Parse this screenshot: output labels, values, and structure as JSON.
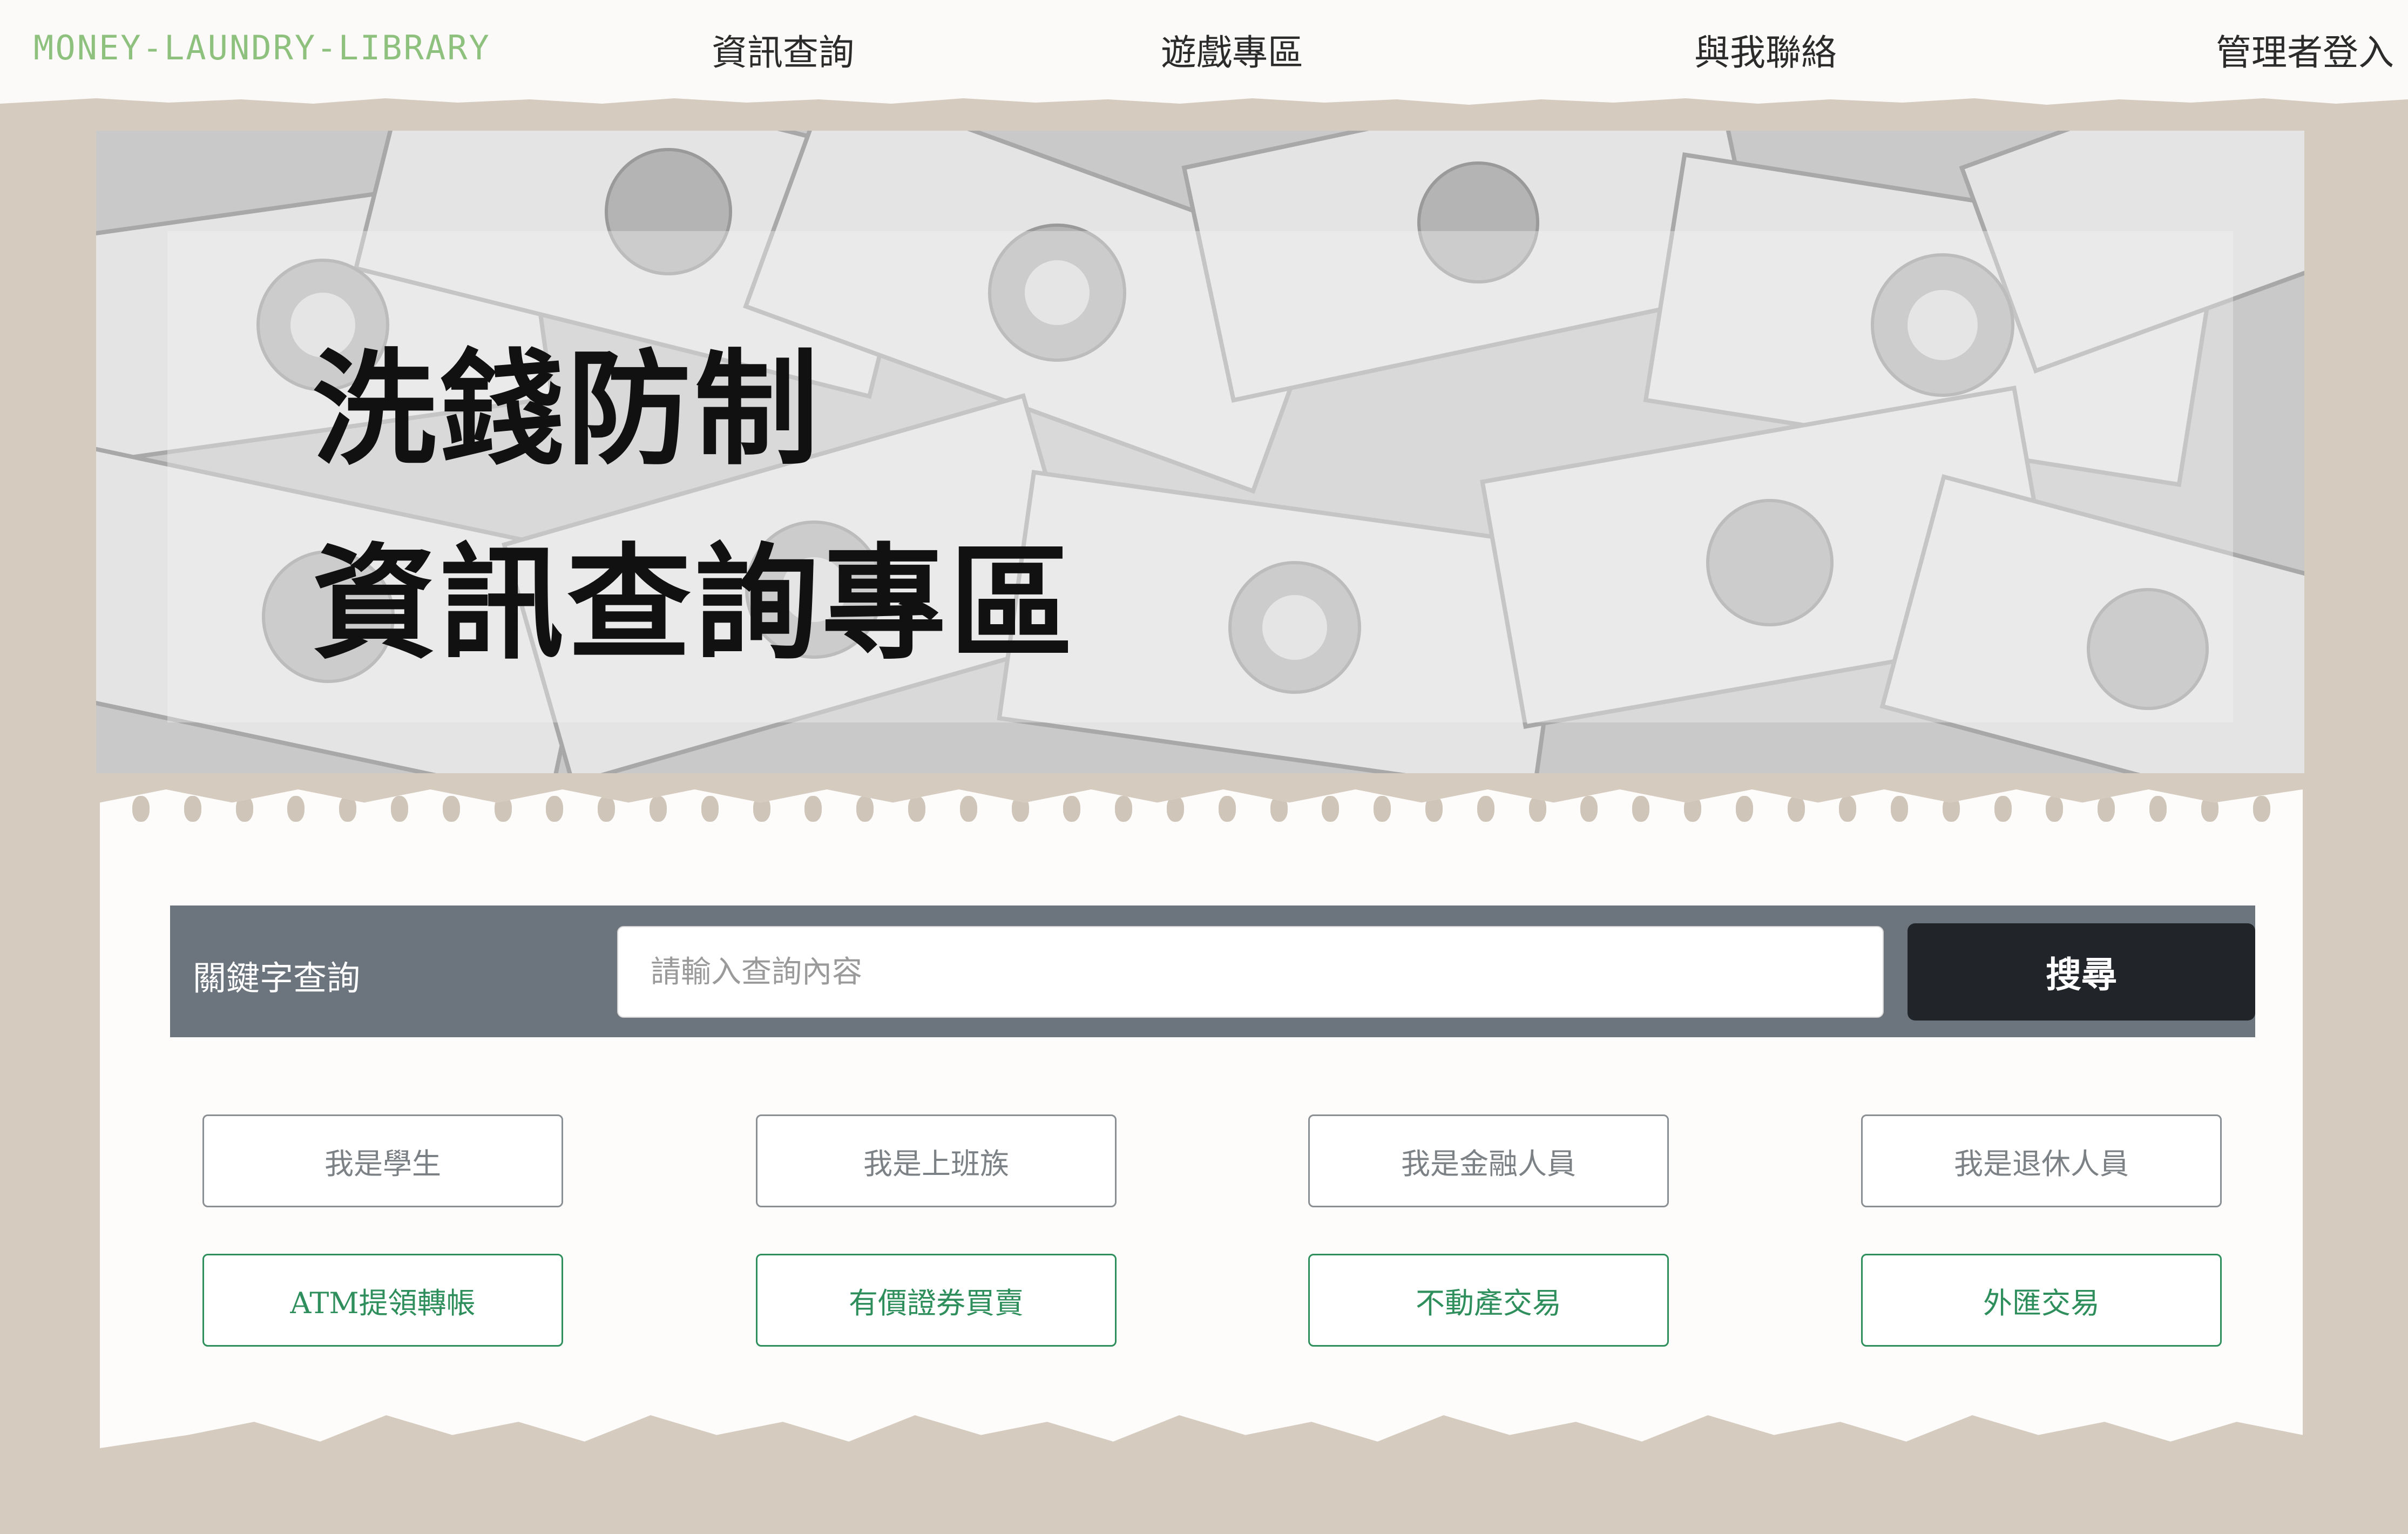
{
  "nav": {
    "brand": "MONEY-LAUNDRY-LIBRARY",
    "links": [
      "資訊查詢",
      "遊戲專區",
      "與我聯絡",
      "管理者登入"
    ]
  },
  "hero": {
    "title_line1": "洗錢防制",
    "title_line2": "資訊查詢專區"
  },
  "search": {
    "label": "關鍵字查詢",
    "placeholder": "請輸入查詢內容",
    "button": "搜尋"
  },
  "categories": {
    "roles": [
      "我是學生",
      "我是上班族",
      "我是金融人員",
      "我是退休人員"
    ],
    "transactions": [
      "ATM提領轉帳",
      "有價證券買賣",
      "不動產交易",
      "外匯交易"
    ]
  },
  "colors": {
    "background": "#d6cbbf",
    "brand": "#8ec07e",
    "search_bar": "#6c757d",
    "search_button": "#212529",
    "category_green": "#2f8f5c",
    "category_gray": "#8a8f94"
  }
}
